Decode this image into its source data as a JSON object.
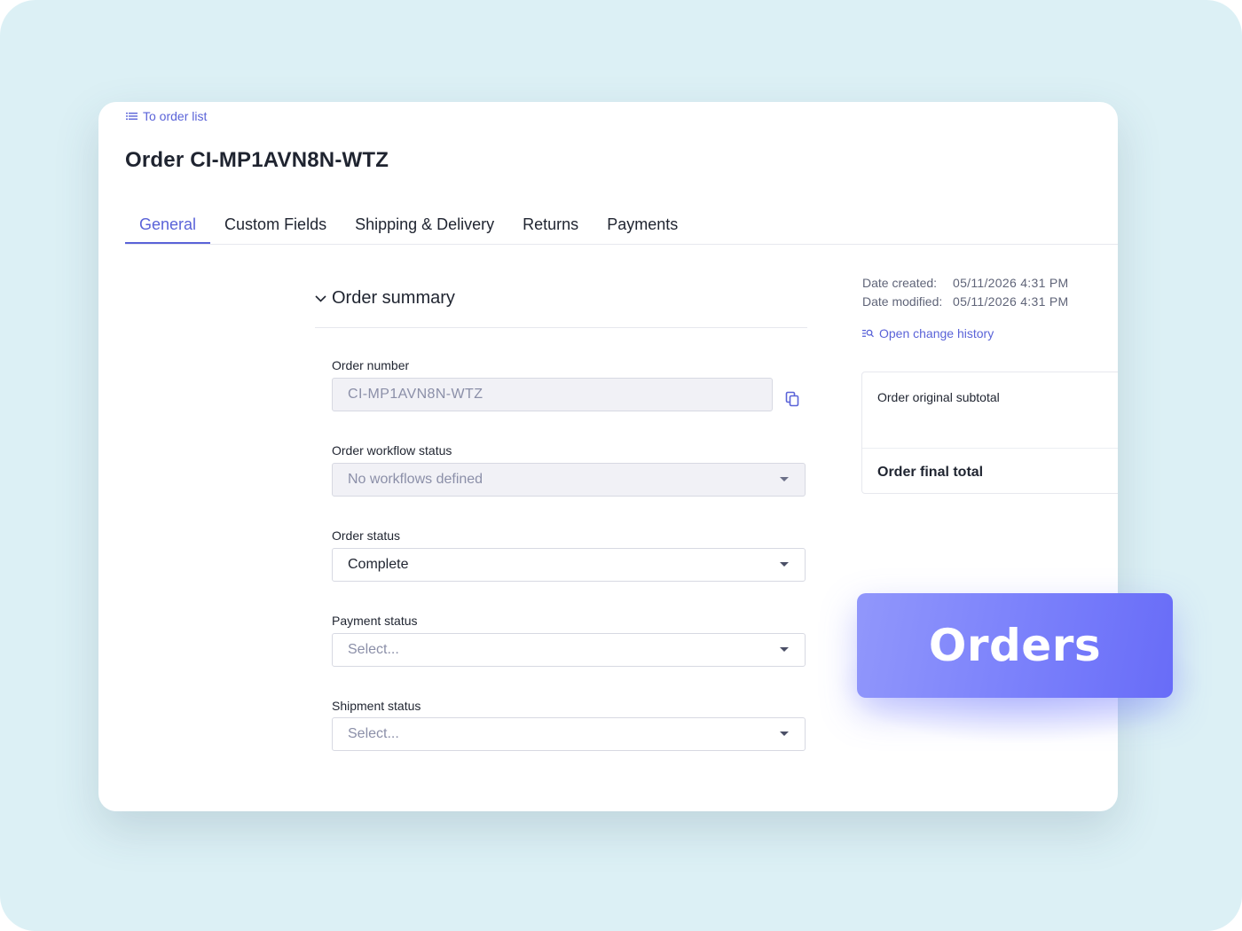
{
  "back_link": {
    "label": "To order list",
    "icon": "list-icon"
  },
  "order_title": "Order CI-MP1AVN8N-WTZ",
  "tabs": [
    {
      "label": "General",
      "active": true
    },
    {
      "label": "Custom Fields",
      "active": false
    },
    {
      "label": "Shipping & Delivery",
      "active": false
    },
    {
      "label": "Returns",
      "active": false
    },
    {
      "label": "Payments",
      "active": false
    }
  ],
  "order_summary": {
    "title": "Order summary",
    "fields": {
      "order_number": {
        "label": "Order number",
        "value": "CI-MP1AVN8N-WTZ"
      },
      "workflow_status": {
        "label": "Order workflow status",
        "value": "No workflows defined"
      },
      "order_status": {
        "label": "Order status",
        "value": "Complete"
      },
      "payment_status": {
        "label": "Payment status",
        "placeholder": "Select..."
      },
      "shipment_status": {
        "label": "Shipment status",
        "placeholder": "Select..."
      }
    }
  },
  "meta": {
    "created_label": "Date created:",
    "created_value": "05/11/2026 4:31 PM",
    "modified_label": "Date modified:",
    "modified_value": "05/11/2026 4:31 PM",
    "history_link": "Open change history"
  },
  "totals": {
    "subtotal_label": "Order original subtotal",
    "final_total_label": "Order final total"
  },
  "badge": {
    "label": "Orders"
  },
  "colors": {
    "accent": "#5a63d8",
    "background": "#dcf0f5",
    "badge_start": "#9197fb",
    "badge_end": "#686cf8"
  }
}
